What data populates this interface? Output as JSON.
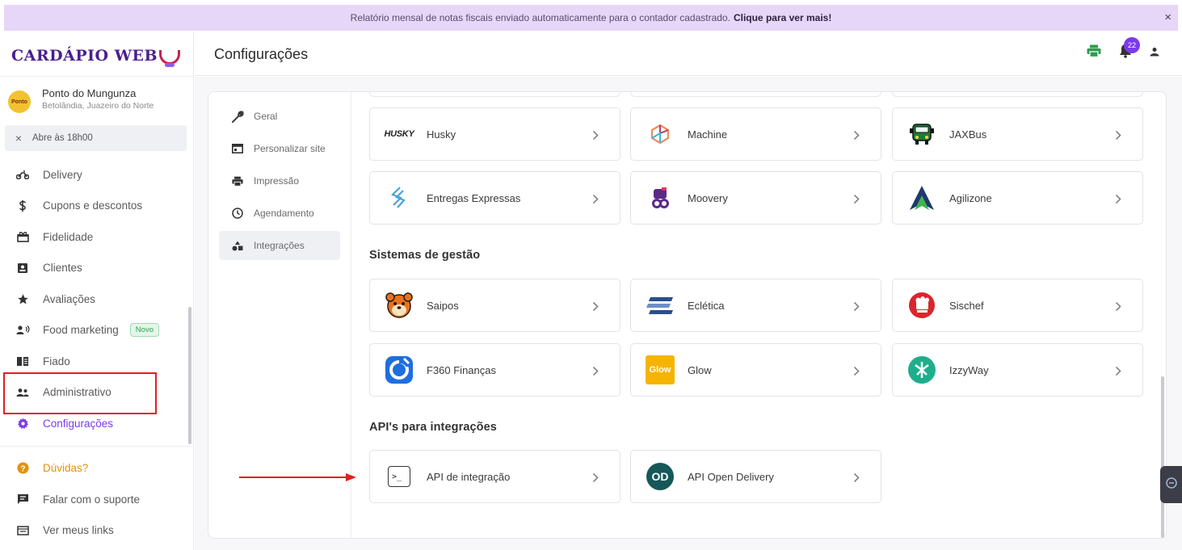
{
  "banner": {
    "text": "Relatório mensal de notas fiscais enviado automaticamente para o contador cadastrado.",
    "link": "Clique para ver mais!",
    "close": "×"
  },
  "brand": {
    "logo_text": "CARDÁPIO WEB"
  },
  "store": {
    "avatar_text": "Ponto",
    "name": "Ponto do Mungunza",
    "location": "Betolândia, Juazeiro do Norte",
    "status_icon": "×",
    "status": "Abre às 18h00"
  },
  "nav": {
    "items": [
      {
        "label": "Delivery",
        "icon": "motorcycle-icon"
      },
      {
        "label": "Cupons e descontos",
        "icon": "discount-icon"
      },
      {
        "label": "Fidelidade",
        "icon": "gift-icon"
      },
      {
        "label": "Clientes",
        "icon": "contact-card-icon"
      },
      {
        "label": "Avaliações",
        "icon": "star-icon"
      },
      {
        "label": "Food marketing",
        "icon": "megaphone-icon",
        "badge": "Novo"
      },
      {
        "label": "Fiado",
        "icon": "book-icon"
      },
      {
        "label": "Administrativo",
        "icon": "users-icon"
      },
      {
        "label": "Configurações",
        "icon": "gear-icon",
        "active": true
      }
    ],
    "footer": [
      {
        "label": "Dúvidas?",
        "icon": "help-icon"
      },
      {
        "label": "Falar com o suporte",
        "icon": "chat-icon"
      },
      {
        "label": "Ver meus links",
        "icon": "link-icon"
      }
    ]
  },
  "header": {
    "title": "Configurações",
    "notification_count": "22"
  },
  "subnav": {
    "items": [
      {
        "label": "Geral",
        "icon": "wrench-icon"
      },
      {
        "label": "Personalizar site",
        "icon": "browser-icon"
      },
      {
        "label": "Impressão",
        "icon": "printer-icon"
      },
      {
        "label": "Agendamento",
        "icon": "clock-icon"
      },
      {
        "label": "Integrações",
        "icon": "shapes-icon",
        "active": true
      }
    ]
  },
  "logistics": [
    {
      "name": "Husky",
      "logo_text": "HUSKY"
    },
    {
      "name": "Machine",
      "logo_text": ""
    },
    {
      "name": "JAXBus",
      "logo_text": ""
    },
    {
      "name": "Entregas Expressas",
      "logo_text": ""
    },
    {
      "name": "Moovery",
      "logo_text": ""
    },
    {
      "name": "Agilizone",
      "logo_text": ""
    }
  ],
  "sections": {
    "management_title": "Sistemas de gestão",
    "api_title": "API's para integrações"
  },
  "management": [
    {
      "name": "Saipos",
      "logo_text": ""
    },
    {
      "name": "Eclética",
      "logo_text": ""
    },
    {
      "name": "Sischef",
      "logo_text": ""
    },
    {
      "name": "F360 Finanças",
      "logo_text": ""
    },
    {
      "name": "Glow",
      "logo_text": "Glow"
    },
    {
      "name": "IzzyWay",
      "logo_text": ""
    }
  ],
  "apis": [
    {
      "name": "API de integração",
      "logo_text": ">_"
    },
    {
      "name": "API Open Delivery",
      "logo_text": "OD"
    }
  ],
  "colors": {
    "accent": "#7c3aed",
    "banner_bg": "#e6d6f8",
    "highlight_box": "#e31e24",
    "arrow": "#e31e24",
    "printer": "#2d9d4e"
  }
}
